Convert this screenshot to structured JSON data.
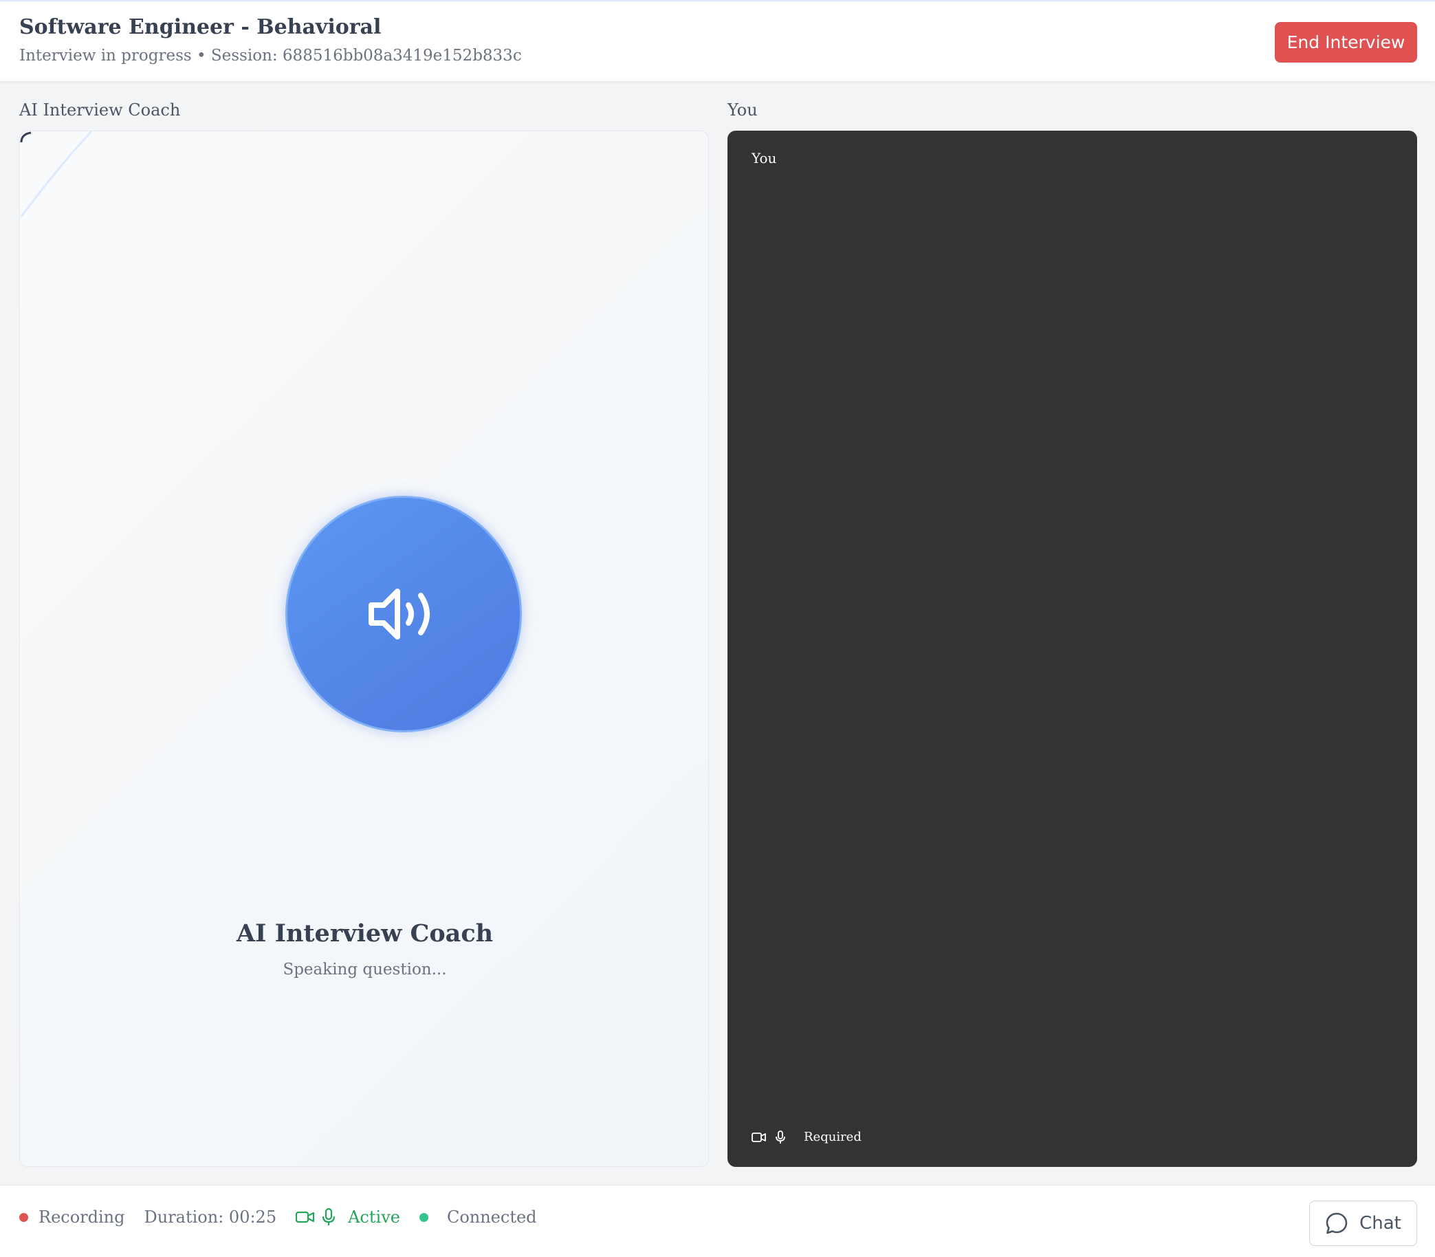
{
  "header": {
    "title": "Software Engineer - Behavioral",
    "subtitle": "Interview in progress • Session: 688516bb08a3419e152b833c",
    "end_button": "End Interview"
  },
  "ai_panel": {
    "label": "AI Interview Coach",
    "name": "AI Interview Coach",
    "status": "Speaking question...",
    "icon": "speaker-icon",
    "accent_color": "#5585e8"
  },
  "user_panel": {
    "label": "You",
    "video_tag": "You",
    "media_status": "Required",
    "background_color": "#333333"
  },
  "footer": {
    "recording_label": "Recording",
    "duration": "Duration: 00:25",
    "media_status": "Active",
    "connection_label": "Connected",
    "chat_button": "Chat",
    "colors": {
      "recording": "#e05252",
      "active": "#22a55b",
      "connected": "#34c38f"
    }
  }
}
